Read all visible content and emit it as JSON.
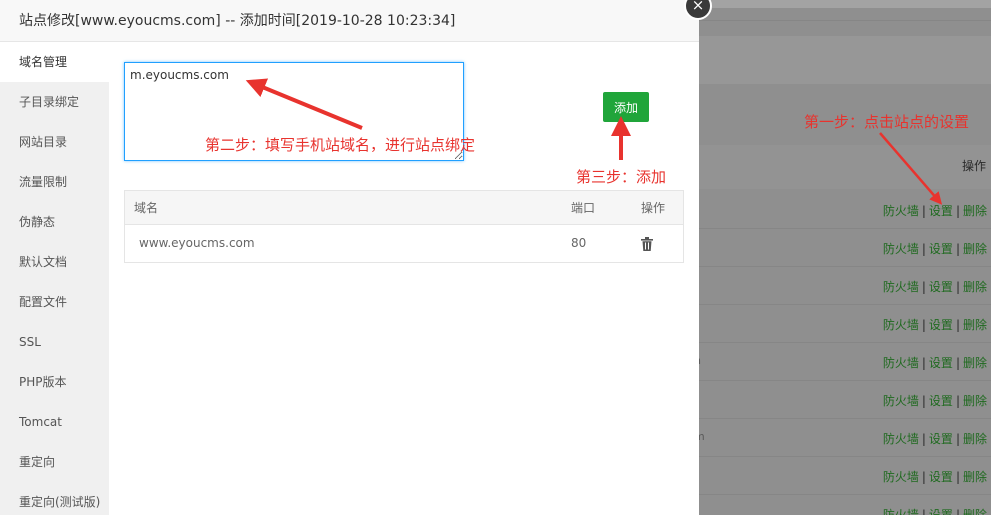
{
  "dialog": {
    "title": "站点修改[www.eyoucms.com] -- 添加时间[2019-10-28 10:23:34]",
    "close_glyph": "×"
  },
  "sidebar": {
    "items": [
      {
        "label": "域名管理",
        "active": true
      },
      {
        "label": "子目录绑定"
      },
      {
        "label": "网站目录"
      },
      {
        "label": "流量限制"
      },
      {
        "label": "伪静态"
      },
      {
        "label": "默认文档"
      },
      {
        "label": "配置文件"
      },
      {
        "label": "SSL"
      },
      {
        "label": "PHP版本"
      },
      {
        "label": "Tomcat"
      },
      {
        "label": "重定向"
      },
      {
        "label": "重定向(测试版)"
      }
    ]
  },
  "domain_input": {
    "value": "m.eyoucms.com"
  },
  "add_button": {
    "label": "添加"
  },
  "table": {
    "headers": {
      "domain": "域名",
      "port": "端口",
      "operation": "操作"
    },
    "rows": [
      {
        "domain": "www.eyoucms.com",
        "port": "80",
        "delete_icon": "trash-icon"
      }
    ]
  },
  "annotations": {
    "step1": "第一步：点击站点的设置",
    "step2": "第二步：填写手机站域名，进行站点绑定",
    "step3": "第三步：添加"
  },
  "background": {
    "header_op": "操作",
    "row_links": {
      "firewall": "防火墙",
      "settings": "设置",
      "delete": "删除",
      "sep": "|"
    },
    "row_count": 9,
    "fragments": [
      "n",
      "m"
    ]
  },
  "colors": {
    "accent_green": "#20a53a",
    "annotation_red": "#e8332e",
    "focus_blue": "#20a0ff"
  }
}
